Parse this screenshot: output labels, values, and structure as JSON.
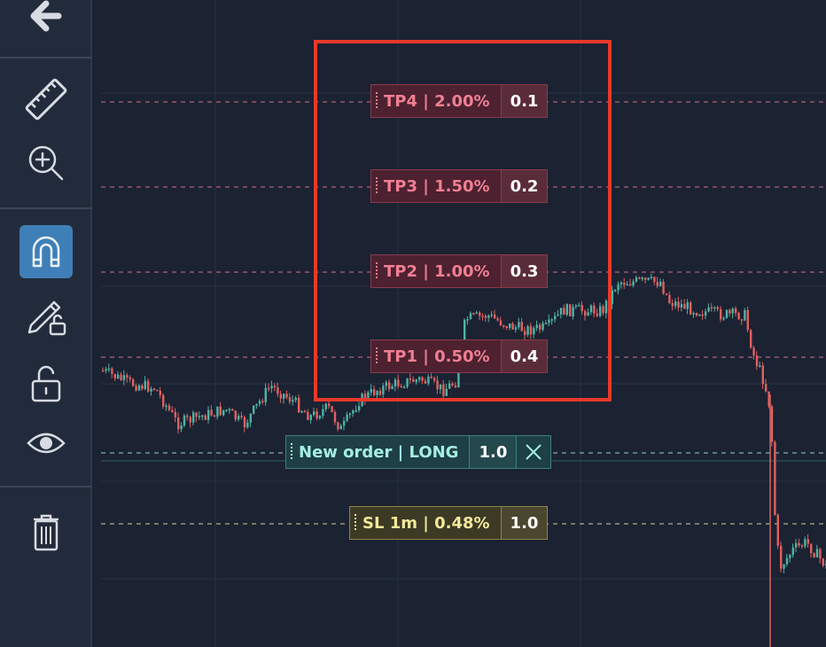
{
  "toolbar": {
    "tools": [
      {
        "name": "back",
        "icon": "arrow-left-icon",
        "active": false
      },
      {
        "name": "measure",
        "icon": "ruler-icon",
        "active": false
      },
      {
        "name": "zoom-in",
        "icon": "zoom-in-icon",
        "active": false
      },
      {
        "name": "magnet",
        "icon": "magnet-icon",
        "active": true
      },
      {
        "name": "lock-drawings",
        "icon": "pencil-lock-icon",
        "active": false
      },
      {
        "name": "lock-all",
        "icon": "unlock-icon",
        "active": false
      },
      {
        "name": "hide-drawings",
        "icon": "eye-icon",
        "active": false
      },
      {
        "name": "remove-drawings",
        "icon": "trash-icon",
        "active": false
      }
    ]
  },
  "chart": {
    "price_lines": {
      "tp4": {
        "label": "TP4 | 2.00%",
        "qty": "0.1"
      },
      "tp3": {
        "label": "TP3 | 1.50%",
        "qty": "0.2"
      },
      "tp2": {
        "label": "TP2 | 1.00%",
        "qty": "0.3"
      },
      "tp1": {
        "label": "TP1 | 0.50%",
        "qty": "0.4"
      },
      "order": {
        "label": "New order | LONG",
        "qty": "1.0",
        "close_icon": "close-icon"
      },
      "sl": {
        "label": "SL 1m | 0.48%",
        "qty": "1.0"
      }
    },
    "colors": {
      "background": "#1b2232",
      "up_candle": "#4fb3a3",
      "down_candle": "#e0615f",
      "take_profit": "#f07f93",
      "order": "#a5efe2",
      "stop_loss": "#f3e79a",
      "highlight": "#e8392b",
      "active_tool": "#3f7fb7"
    }
  }
}
